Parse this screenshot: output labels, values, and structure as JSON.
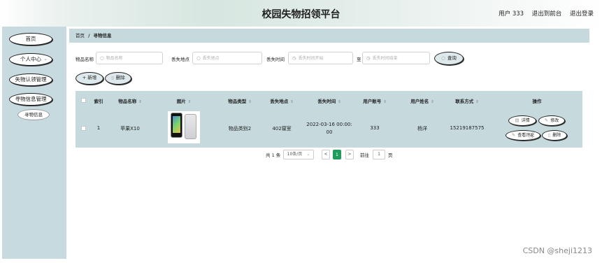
{
  "header": {
    "title": "校园失物招领平台",
    "user": "用户 333",
    "back_front": "退出到前台",
    "logout": "退出登录"
  },
  "sidebar": {
    "items": [
      {
        "label": "首页"
      },
      {
        "label": "个人中心",
        "chevron": "⌄"
      },
      {
        "label": "失物认领管理"
      },
      {
        "label": "寻物信息管理"
      }
    ],
    "sub_items": [
      {
        "label": "寻物信息"
      }
    ]
  },
  "breadcrumb": {
    "home": "首页",
    "sep": "/",
    "current": "寻物信息"
  },
  "filters": {
    "name_label": "物品名称",
    "name_placeholder": "物品名称",
    "place_label": "丢失地点",
    "place_placeholder": "丢失地点",
    "time_label": "丢失时间",
    "time_start_placeholder": "丢失时间开始",
    "to": "至",
    "time_end_placeholder": "丢失时间结束",
    "query": "查询"
  },
  "actions": {
    "add": "+ 新增",
    "delete": "删除"
  },
  "table": {
    "headers": [
      "索引",
      "物品名称",
      "图片",
      "物品类型",
      "丢失地点",
      "丢失时间",
      "用户账号",
      "用户姓名",
      "联系方式",
      "操作"
    ],
    "rows": [
      {
        "index": "1",
        "name": "苹果X10",
        "type": "物品类别2",
        "place": "402寝室",
        "time_line1": "2022-03-16 00:00:",
        "time_line2": "00",
        "account": "333",
        "username": "杨洋",
        "phone": "15219187575",
        "ops": [
          "详情",
          "修改",
          "查看评论",
          "删除"
        ]
      }
    ]
  },
  "pagination": {
    "total": "共 1 条",
    "page_size": "10条/页",
    "prev": "<",
    "current": "1",
    "next": ">",
    "goto": "前往",
    "goto_value": "1",
    "page_unit": "页"
  },
  "watermark": "CSDN @sheji1213",
  "colors": {
    "sidebar": "#c7dadf",
    "table_bg": "#c6d9dd",
    "page_active": "#1f9c5c"
  }
}
